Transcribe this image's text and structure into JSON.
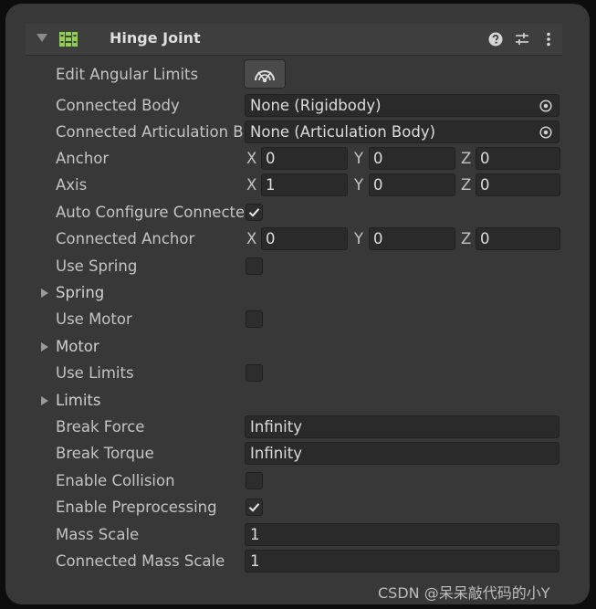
{
  "header": {
    "title": "Hinge Joint"
  },
  "fields": {
    "edit_angular_limits": {
      "label": "Edit Angular Limits"
    },
    "connected_body": {
      "label": "Connected Body",
      "value": "None (Rigidbody)"
    },
    "connected_articulation_body": {
      "label": "Connected Articulation B",
      "value": "None (Articulation Body)"
    },
    "anchor": {
      "label": "Anchor",
      "x_label": "X",
      "x": "0",
      "y_label": "Y",
      "y": "0",
      "z_label": "Z",
      "z": "0"
    },
    "axis": {
      "label": "Axis",
      "x_label": "X",
      "x": "1",
      "y_label": "Y",
      "y": "0",
      "z_label": "Z",
      "z": "0"
    },
    "auto_configure": {
      "label": "Auto Configure Connecte",
      "checked": true
    },
    "connected_anchor": {
      "label": "Connected Anchor",
      "x_label": "X",
      "x": "0",
      "y_label": "Y",
      "y": "0",
      "z_label": "Z",
      "z": "0"
    },
    "use_spring": {
      "label": "Use Spring",
      "checked": false
    },
    "spring": {
      "label": "Spring"
    },
    "use_motor": {
      "label": "Use Motor",
      "checked": false
    },
    "motor": {
      "label": "Motor"
    },
    "use_limits": {
      "label": "Use Limits",
      "checked": false
    },
    "limits": {
      "label": "Limits"
    },
    "break_force": {
      "label": "Break Force",
      "value": "Infinity"
    },
    "break_torque": {
      "label": "Break Torque",
      "value": "Infinity"
    },
    "enable_collision": {
      "label": "Enable Collision",
      "checked": false
    },
    "enable_preprocessing": {
      "label": "Enable Preprocessing",
      "checked": true
    },
    "mass_scale": {
      "label": "Mass Scale",
      "value": "1"
    },
    "connected_mass_scale": {
      "label": "Connected Mass Scale",
      "value": "1"
    }
  },
  "watermark": "CSDN @呆呆敲代码的小Y",
  "icons": {
    "component": "hinge-joint-icon",
    "help": "help-icon",
    "presets": "presets-icon",
    "menu": "kebab-menu-icon",
    "picker": "object-picker-icon"
  },
  "colors": {
    "background": "#383838",
    "field": "#2a2a2a",
    "text": "#c4c4c4",
    "component_icon": "#8fd14f"
  }
}
